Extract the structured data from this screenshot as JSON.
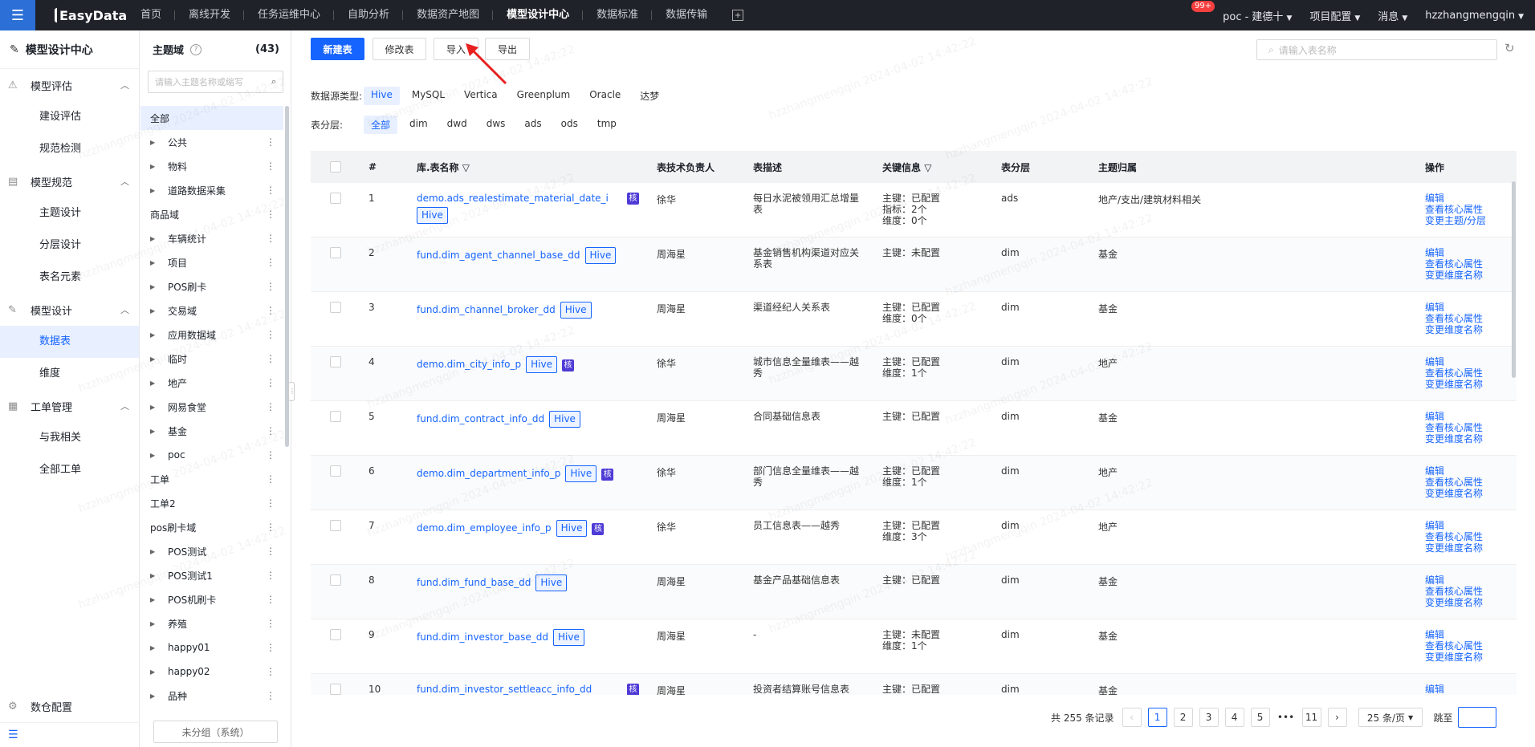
{
  "topbar": {
    "brand": "EasyData",
    "nav": [
      "首页",
      "离线开发",
      "任务运维中心",
      "自助分析",
      "数据资产地图",
      "模型设计中心",
      "数据标准",
      "数据传输"
    ],
    "active_index": 5,
    "project": "poc - 建德十",
    "project_config": "项目配置",
    "messages": "消息",
    "badge": "99+",
    "user": "hzzhangmengqin"
  },
  "sidebar": {
    "title": "模型设计中心",
    "groups": [
      {
        "label": "模型评估",
        "icon": "warning-icon",
        "items": [
          "建设评估",
          "规范检测"
        ]
      },
      {
        "label": "模型规范",
        "icon": "id-card-icon",
        "items": [
          "主题设计",
          "分层设计",
          "表名元素"
        ]
      },
      {
        "label": "模型设计",
        "icon": "edit-icon",
        "items": [
          "数据表",
          "维度"
        ]
      },
      {
        "label": "工单管理",
        "icon": "grid-icon",
        "items": [
          "与我相关",
          "全部工单"
        ]
      }
    ],
    "active_item": "数据表",
    "bottom": "数仓配置"
  },
  "topic": {
    "title": "主题域",
    "count": "(43)",
    "search_placeholder": "请输入主题名称或缩写",
    "items": [
      {
        "label": "全部",
        "arrow": false,
        "all": true
      },
      {
        "label": "公共",
        "arrow": true
      },
      {
        "label": "物料",
        "arrow": true
      },
      {
        "label": "道路数据采集",
        "arrow": true
      },
      {
        "label": "商品域",
        "arrow": false
      },
      {
        "label": "车辆统计",
        "arrow": true
      },
      {
        "label": "项目",
        "arrow": true
      },
      {
        "label": "POS刷卡",
        "arrow": true
      },
      {
        "label": "交易域",
        "arrow": true
      },
      {
        "label": "应用数据域",
        "arrow": true
      },
      {
        "label": "临时",
        "arrow": true
      },
      {
        "label": "地产",
        "arrow": true
      },
      {
        "label": "网易食堂",
        "arrow": true
      },
      {
        "label": "基金",
        "arrow": true
      },
      {
        "label": "poc",
        "arrow": true
      },
      {
        "label": "工单",
        "arrow": false
      },
      {
        "label": "工单2",
        "arrow": false
      },
      {
        "label": "pos刷卡域",
        "arrow": false
      },
      {
        "label": "POS测试",
        "arrow": true
      },
      {
        "label": "POS测试1",
        "arrow": true
      },
      {
        "label": "POS机刷卡",
        "arrow": true
      },
      {
        "label": "养殖",
        "arrow": true
      },
      {
        "label": "happy01",
        "arrow": true
      },
      {
        "label": "happy02",
        "arrow": true
      },
      {
        "label": "品种",
        "arrow": true
      }
    ],
    "footer": "未分组（系统）"
  },
  "toolbar": {
    "new": "新建表",
    "edit": "修改表",
    "import": "导入",
    "export": "导出",
    "search_placeholder": "请输入表名称"
  },
  "filters": {
    "source_label": "数据源类型:",
    "sources": [
      "Hive",
      "MySQL",
      "Vertica",
      "Greenplum",
      "Oracle",
      "达梦"
    ],
    "source_selected": "Hive",
    "layer_label": "表分层:",
    "layers": [
      "全部",
      "dim",
      "dwd",
      "dws",
      "ads",
      "ods",
      "tmp"
    ],
    "layer_selected": "全部"
  },
  "table": {
    "headers": {
      "num": "#",
      "name": "库.表名称",
      "owner": "表技术负责人",
      "desc": "表描述",
      "key": "关键信息",
      "layer": "表分层",
      "subject": "主题归属",
      "ops": "操作"
    },
    "rows": [
      {
        "num": "1",
        "name": "demo.ads_realestimate_material_date_i",
        "tag": "Hive",
        "he": true,
        "owner": "徐华",
        "desc": [
          "每日水泥被领用汇总增量",
          "表"
        ],
        "key": [
          "主键：已配置",
          "指标：2个",
          "维度：0个"
        ],
        "layer": "ads",
        "subject": "地产/支出/建筑材料相关",
        "ops": [
          "编辑",
          "查看核心属性",
          "变更主题/分层"
        ]
      },
      {
        "num": "2",
        "name": "fund.dim_agent_channel_base_dd",
        "tag": "Hive",
        "he": false,
        "owner": "周海星",
        "desc": [
          "基金销售机构渠道对应关",
          "系表"
        ],
        "key": [
          "主键：未配置"
        ],
        "layer": "dim",
        "subject": "基金",
        "ops": [
          "编辑",
          "查看核心属性",
          "变更维度名称"
        ]
      },
      {
        "num": "3",
        "name": "fund.dim_channel_broker_dd",
        "tag": "Hive",
        "he": false,
        "owner": "周海星",
        "desc": [
          "渠道经纪人关系表"
        ],
        "key": [
          "主键：已配置",
          "维度：0个"
        ],
        "layer": "dim",
        "subject": "基金",
        "ops": [
          "编辑",
          "查看核心属性",
          "变更维度名称"
        ]
      },
      {
        "num": "4",
        "name": "demo.dim_city_info_p",
        "tag": "Hive",
        "he": true,
        "owner": "徐华",
        "desc": [
          "城市信息全量维表——越",
          "秀"
        ],
        "key": [
          "主键：已配置",
          "维度：1个"
        ],
        "layer": "dim",
        "subject": "地产",
        "ops": [
          "编辑",
          "查看核心属性",
          "变更维度名称"
        ]
      },
      {
        "num": "5",
        "name": "fund.dim_contract_info_dd",
        "tag": "Hive",
        "he": false,
        "owner": "周海星",
        "desc": [
          "合同基础信息表"
        ],
        "key": [
          "主键：已配置"
        ],
        "layer": "dim",
        "subject": "基金",
        "ops": [
          "编辑",
          "查看核心属性",
          "变更维度名称"
        ]
      },
      {
        "num": "6",
        "name": "demo.dim_department_info_p",
        "tag": "Hive",
        "he": true,
        "owner": "徐华",
        "desc": [
          "部门信息全量维表——越",
          "秀"
        ],
        "key": [
          "主键：已配置",
          "维度：1个"
        ],
        "layer": "dim",
        "subject": "地产",
        "ops": [
          "编辑",
          "查看核心属性",
          "变更维度名称"
        ]
      },
      {
        "num": "7",
        "name": "demo.dim_employee_info_p",
        "tag": "Hive",
        "he": true,
        "owner": "徐华",
        "desc": [
          "员工信息表——越秀"
        ],
        "key": [
          "主键：已配置",
          "维度：3个"
        ],
        "layer": "dim",
        "subject": "地产",
        "ops": [
          "编辑",
          "查看核心属性",
          "变更维度名称"
        ]
      },
      {
        "num": "8",
        "name": "fund.dim_fund_base_dd",
        "tag": "Hive",
        "he": false,
        "owner": "周海星",
        "desc": [
          "基金产品基础信息表"
        ],
        "key": [
          "主键：已配置"
        ],
        "layer": "dim",
        "subject": "基金",
        "ops": [
          "编辑",
          "查看核心属性",
          "变更维度名称"
        ]
      },
      {
        "num": "9",
        "name": "fund.dim_investor_base_dd",
        "tag": "Hive",
        "he": false,
        "owner": "周海星",
        "desc": [
          "-"
        ],
        "key": [
          "主键：未配置",
          "维度：1个"
        ],
        "layer": "dim",
        "subject": "基金",
        "ops": [
          "编辑",
          "查看核心属性",
          "变更维度名称"
        ]
      },
      {
        "num": "10",
        "name": "fund.dim_investor_settleacc_info_dd",
        "tag": "Hive",
        "he": false,
        "owner": "周海星",
        "desc": [
          "投资者结算账号信息表"
        ],
        "key": [
          "主键：已配置"
        ],
        "layer": "dim",
        "subject": "基金",
        "ops": [
          "编辑"
        ]
      }
    ]
  },
  "pagination": {
    "total": "共 255 条记录",
    "pages": [
      "1",
      "2",
      "3",
      "4",
      "5",
      "•••",
      "11"
    ],
    "current": "1",
    "size": "25 条/页",
    "jump_label": "跳至"
  },
  "watermark": "hzzhangmengqin 2024-04-02 14:42:22",
  "he_label": "核"
}
